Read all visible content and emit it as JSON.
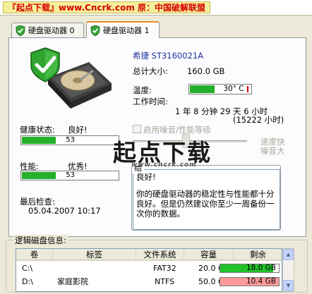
{
  "banner": "『起点下载』www.Cncrk.com 原：中国破解联盟",
  "tabs": [
    {
      "label": "硬盘驱动器 0",
      "active": false
    },
    {
      "label": "硬盘驱动器 1",
      "active": true
    }
  ],
  "drive": {
    "model": "希捷 ST3160021A",
    "capacity_label": "总计大小:",
    "capacity_value": "160.0 GB",
    "temp_label": "温度:",
    "temp_value": "30° C",
    "temp_fraction": 0.4,
    "uptime_label": "工作时间:",
    "uptime_value": "1 年 8 分钟 29 天 6 小时",
    "uptime_hours": "(15222 小时)"
  },
  "health": {
    "label": "健康状态:",
    "status": "良好!",
    "percent": 53,
    "bar_text": "53"
  },
  "performance": {
    "label": "性能:",
    "status": "优秀!",
    "percent": 53,
    "bar_text": "53"
  },
  "last_check": {
    "label": "最后检查:",
    "value": "05.04.2007 10:17"
  },
  "noise": {
    "checkbox_label": "启用噪音/性能等级",
    "fast_label": "速度快",
    "loud_label": "噪音大",
    "checked": false
  },
  "advice": {
    "group_label": "给",
    "line1": "良好!",
    "body": "你的硬盘驱动器的稳定性与性能都十分良好。但是仍然建议你至少一周备份一次你的数据。"
  },
  "watermark": {
    "logo": "起点下载",
    "url": "www.cncrk.com"
  },
  "disks": {
    "title": "逻辑磁盘信息:",
    "columns": [
      "卷",
      "标签",
      "文件系统",
      "容量",
      "剩余"
    ],
    "rows": [
      {
        "volume": "C:\\",
        "label": "",
        "fs": "FAT32",
        "size": "20.0 GB",
        "free": "18.0 GB",
        "free_fraction": 0.9,
        "low": false
      },
      {
        "volume": "D:\\",
        "label": "家庭影院",
        "fs": "NTFS",
        "size": "50.0 GB",
        "free": "10.4 GB",
        "free_fraction": 0.21,
        "low": true
      }
    ]
  },
  "colors": {
    "accent_green": "#23b02a",
    "warning_red": "#ff9a9a",
    "banner_red": "#d40000"
  }
}
